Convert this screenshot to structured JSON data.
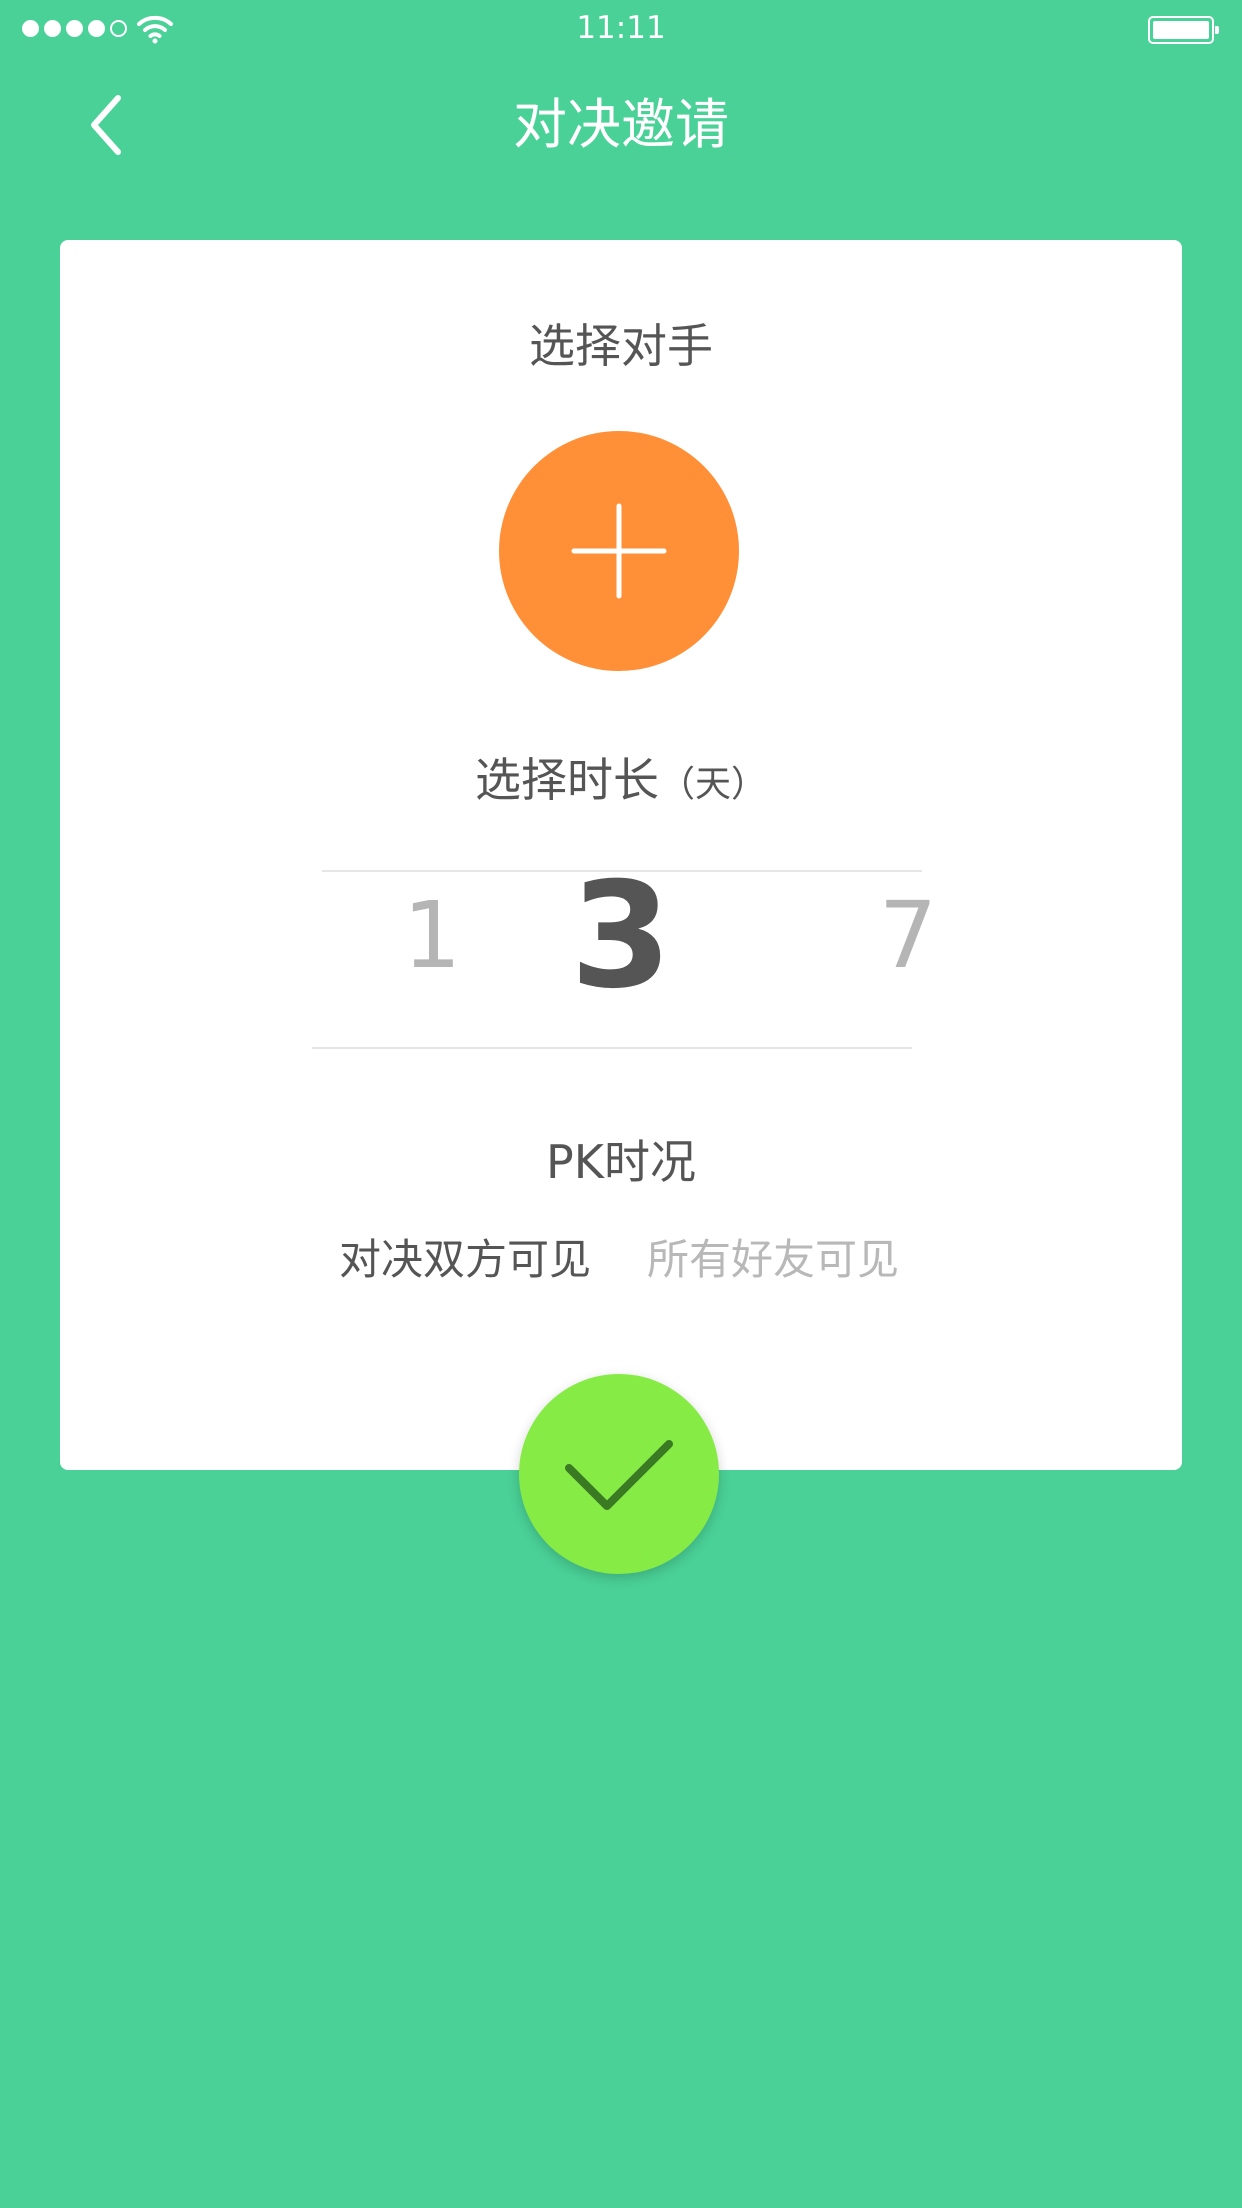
{
  "status_bar": {
    "time": "11:11",
    "signal_icon": "signal-dots-icon",
    "wifi_icon": "wifi-icon",
    "battery_icon": "battery-icon",
    "battery_level": 1.0
  },
  "nav": {
    "title": "对决邀请",
    "back_icon": "chevron-left-icon"
  },
  "opponent": {
    "label": "选择对手",
    "add_icon": "plus-icon"
  },
  "duration": {
    "label": "选择时长",
    "unit": "（天）",
    "options": [
      "1",
      "3",
      "7"
    ],
    "selected": "3"
  },
  "visibility": {
    "label": "PK时况",
    "options": [
      "对决双方可见",
      "所有好友可见"
    ],
    "selected": "对决双方可见"
  },
  "confirm": {
    "icon": "checkmark-icon"
  },
  "colors": {
    "background": "#4ad197",
    "card": "#ffffff",
    "accent_orange": "#ff9038",
    "confirm_green": "#86eb45",
    "text_dark": "#555555",
    "text_muted": "#b5b5b5"
  }
}
